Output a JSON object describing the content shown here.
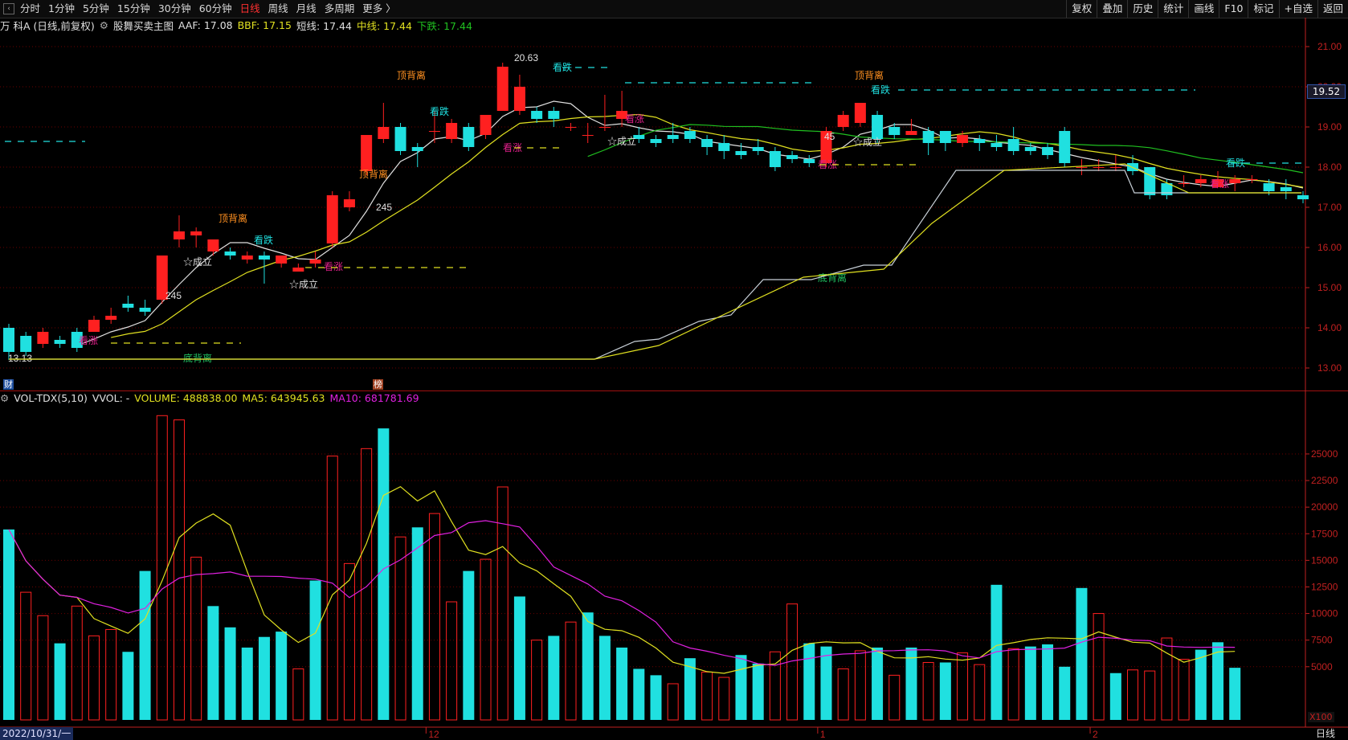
{
  "toolbar": {
    "back_icon": "back-icon",
    "periods": [
      "分时",
      "1分钟",
      "5分钟",
      "15分钟",
      "30分钟",
      "60分钟",
      "日线",
      "周线",
      "月线",
      "多周期",
      "更多 〉"
    ],
    "active_period": "日线",
    "right_tools": [
      "复权",
      "叠加",
      "历史",
      "统计",
      "画线",
      "F10",
      "标记",
      "+自选",
      "返回"
    ]
  },
  "info": {
    "stock": "万 科A (日线,前复权)",
    "indicator": "股舞买卖主图",
    "aaf": "AAF: 17.08",
    "bbf": "BBF: 17.15",
    "short": "短线: 17.44",
    "mid": "中线: 17.44",
    "down": "下跌: 17.44"
  },
  "vol_info": {
    "name": "VOL-TDX(5,10)",
    "vvol": "VVOL: -",
    "volume": "VOLUME: 488838.00",
    "ma5": "MA5: 643945.63",
    "ma10": "MA10: 681781.69"
  },
  "colors": {
    "up": "#ff2020",
    "down": "#20e0e0",
    "ma_white": "#e0e0e0",
    "ma_yellow": "#e0e020",
    "ma_green": "#20c020",
    "magenta": "#e020e0",
    "grid": "#6a0000",
    "axis": "#c02020"
  },
  "price_axis": {
    "labels": [
      "21.00",
      "20.00",
      "19.00",
      "18.00",
      "17.00",
      "16.00",
      "15.00",
      "14.00",
      "13.00"
    ],
    "current": "19.52"
  },
  "volume_axis": {
    "labels": [
      "25000",
      "22500",
      "20000",
      "17500",
      "15000",
      "12500",
      "10000",
      "7500",
      "5000"
    ],
    "unit": "X100"
  },
  "period_label": "日线",
  "date_label": "2022/10/31/一",
  "month_labels": [
    "12",
    "1",
    "2"
  ],
  "badges": {
    "fin": "财",
    "rank": "榜"
  },
  "annotations": {
    "high": "20.63",
    "low": "13.13",
    "dingbeili": "顶背离",
    "dibeili": "底背离",
    "kandie": "看跌",
    "kanzhang": "看涨",
    "chengli": "☆成立",
    "n245": "245",
    "n45": "45"
  },
  "chart_data": {
    "type": "candlestick",
    "price_range": [
      12.8,
      21.2
    ],
    "candles": [
      [
        14.0,
        13.4,
        14.1,
        13.2
      ],
      [
        13.8,
        13.4,
        13.9,
        13.3
      ],
      [
        13.6,
        13.9,
        14.0,
        13.5
      ],
      [
        13.7,
        13.6,
        13.8,
        13.5
      ],
      [
        13.9,
        13.5,
        14.0,
        13.4
      ],
      [
        13.9,
        14.2,
        14.3,
        13.9
      ],
      [
        14.2,
        14.3,
        14.5,
        14.1
      ],
      [
        14.6,
        14.5,
        14.8,
        14.4
      ],
      [
        14.5,
        14.4,
        14.7,
        14.3
      ],
      [
        14.7,
        15.8,
        15.8,
        14.6
      ],
      [
        16.2,
        16.4,
        16.8,
        16.0
      ],
      [
        16.3,
        16.4,
        16.5,
        16.0
      ],
      [
        15.9,
        16.2,
        16.2,
        15.8
      ],
      [
        15.9,
        15.8,
        16.0,
        15.7
      ],
      [
        15.7,
        15.8,
        15.9,
        15.6
      ],
      [
        15.8,
        15.7,
        15.9,
        15.1
      ],
      [
        15.6,
        15.8,
        15.8,
        15.5
      ],
      [
        15.4,
        15.5,
        15.6,
        15.4
      ],
      [
        15.6,
        15.7,
        15.9,
        15.5
      ],
      [
        16.1,
        17.3,
        17.4,
        16.0
      ],
      [
        17.0,
        17.2,
        17.4,
        16.9
      ],
      [
        17.9,
        18.8,
        18.8,
        17.8
      ],
      [
        18.7,
        19.0,
        19.6,
        18.6
      ],
      [
        19.0,
        18.4,
        19.1,
        18.3
      ],
      [
        18.5,
        18.4,
        18.6,
        18.0
      ],
      [
        18.9,
        18.9,
        19.4,
        18.6
      ],
      [
        18.7,
        19.1,
        19.2,
        18.6
      ],
      [
        19.0,
        18.5,
        19.1,
        18.4
      ],
      [
        18.8,
        19.3,
        19.3,
        18.7
      ],
      [
        19.4,
        20.5,
        20.6,
        19.4
      ],
      [
        19.4,
        20.0,
        20.3,
        19.3
      ],
      [
        19.4,
        19.2,
        19.5,
        19.1
      ],
      [
        19.4,
        19.2,
        19.5,
        19.0
      ],
      [
        19.0,
        19.0,
        19.1,
        18.9
      ],
      [
        18.8,
        18.8,
        19.1,
        18.6
      ],
      [
        19.0,
        19.0,
        19.8,
        18.9
      ],
      [
        19.2,
        19.4,
        19.9,
        19.0
      ],
      [
        18.8,
        18.7,
        19.0,
        18.6
      ],
      [
        18.7,
        18.6,
        18.8,
        18.5
      ],
      [
        18.8,
        18.7,
        19.1,
        18.6
      ],
      [
        18.9,
        18.7,
        19.0,
        18.6
      ],
      [
        18.7,
        18.5,
        18.8,
        18.3
      ],
      [
        18.6,
        18.4,
        18.8,
        18.2
      ],
      [
        18.4,
        18.3,
        18.6,
        18.2
      ],
      [
        18.5,
        18.4,
        18.7,
        18.3
      ],
      [
        18.4,
        18.0,
        18.5,
        17.9
      ],
      [
        18.3,
        18.2,
        18.4,
        18.1
      ],
      [
        18.2,
        18.1,
        18.3,
        18.0
      ],
      [
        18.1,
        18.9,
        19.0,
        18.0
      ],
      [
        19.0,
        19.3,
        19.4,
        18.9
      ],
      [
        19.1,
        19.6,
        19.6,
        19.0
      ],
      [
        19.3,
        18.7,
        19.4,
        18.6
      ],
      [
        19.0,
        18.8,
        19.1,
        18.7
      ],
      [
        18.8,
        18.9,
        19.2,
        18.8
      ],
      [
        18.9,
        18.6,
        19.0,
        18.3
      ],
      [
        18.9,
        18.6,
        18.9,
        18.4
      ],
      [
        18.6,
        18.8,
        18.9,
        18.5
      ],
      [
        18.7,
        18.6,
        18.8,
        18.4
      ],
      [
        18.6,
        18.5,
        18.8,
        18.4
      ],
      [
        18.7,
        18.4,
        19.0,
        18.3
      ],
      [
        18.5,
        18.4,
        18.6,
        18.3
      ],
      [
        18.5,
        18.3,
        18.6,
        18.2
      ],
      [
        18.9,
        18.1,
        19.0,
        18.0
      ],
      [
        18.0,
        18.0,
        18.2,
        17.8
      ],
      [
        18.0,
        18.0,
        18.2,
        17.9
      ],
      [
        18.0,
        18.0,
        18.3,
        17.9
      ],
      [
        18.1,
        17.9,
        18.3,
        17.8
      ],
      [
        18.0,
        17.3,
        18.0,
        17.2
      ],
      [
        17.6,
        17.3,
        17.7,
        17.2
      ],
      [
        17.6,
        17.6,
        17.8,
        17.5
      ],
      [
        17.6,
        17.7,
        17.8,
        17.5
      ],
      [
        17.5,
        17.7,
        17.9,
        17.5
      ],
      [
        17.6,
        17.7,
        17.8,
        17.4
      ],
      [
        17.7,
        17.7,
        17.8,
        17.6
      ],
      [
        17.6,
        17.4,
        17.7,
        17.3
      ],
      [
        17.5,
        17.4,
        17.7,
        17.2
      ],
      [
        17.3,
        17.2,
        17.4,
        17.1
      ]
    ],
    "volume_range": [
      0,
      29000
    ],
    "volumes": [
      [
        17900,
        0
      ],
      [
        12000,
        1
      ],
      [
        9800,
        1
      ],
      [
        7200,
        0
      ],
      [
        10700,
        1
      ],
      [
        7900,
        1
      ],
      [
        8500,
        1
      ],
      [
        6400,
        0
      ],
      [
        14000,
        0
      ],
      [
        28600,
        1
      ],
      [
        28200,
        1
      ],
      [
        15300,
        1
      ],
      [
        10700,
        0
      ],
      [
        8700,
        0
      ],
      [
        6800,
        0
      ],
      [
        7800,
        0
      ],
      [
        8300,
        0
      ],
      [
        4800,
        1
      ],
      [
        13100,
        0
      ],
      [
        24800,
        1
      ],
      [
        14700,
        1
      ],
      [
        25500,
        1
      ],
      [
        27400,
        0
      ],
      [
        17200,
        1
      ],
      [
        18100,
        0
      ],
      [
        19400,
        1
      ],
      [
        11100,
        1
      ],
      [
        14000,
        0
      ],
      [
        15100,
        1
      ],
      [
        21900,
        1
      ],
      [
        11600,
        0
      ],
      [
        7500,
        1
      ],
      [
        7900,
        0
      ],
      [
        9200,
        1
      ],
      [
        10100,
        0
      ],
      [
        7900,
        0
      ],
      [
        6800,
        0
      ],
      [
        4800,
        0
      ],
      [
        4200,
        0
      ],
      [
        3400,
        1
      ],
      [
        5800,
        0
      ],
      [
        4500,
        1
      ],
      [
        4000,
        1
      ],
      [
        6100,
        0
      ],
      [
        5300,
        0
      ],
      [
        6400,
        1
      ],
      [
        10900,
        1
      ],
      [
        7200,
        0
      ],
      [
        6900,
        0
      ],
      [
        4800,
        1
      ],
      [
        6500,
        1
      ],
      [
        6800,
        0
      ],
      [
        4200,
        1
      ],
      [
        6800,
        0
      ],
      [
        5400,
        1
      ],
      [
        5400,
        0
      ],
      [
        6300,
        1
      ],
      [
        5200,
        1
      ],
      [
        12700,
        0
      ],
      [
        6700,
        1
      ],
      [
        6900,
        0
      ],
      [
        7100,
        0
      ],
      [
        5000,
        0
      ],
      [
        12400,
        0
      ],
      [
        10000,
        1
      ],
      [
        4400,
        0
      ],
      [
        4700,
        1
      ],
      [
        4600,
        1
      ],
      [
        7700,
        1
      ],
      [
        5700,
        1
      ],
      [
        6600,
        0
      ],
      [
        7300,
        0
      ],
      [
        4900,
        0
      ]
    ]
  }
}
